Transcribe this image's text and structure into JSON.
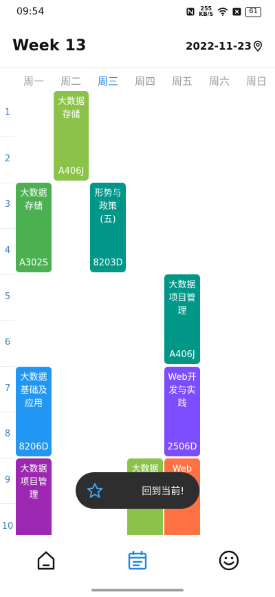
{
  "status": {
    "time": "09:54",
    "net_speed_value": "255",
    "net_speed_unit": "KB/S",
    "battery": "61"
  },
  "header": {
    "week_title": "Week 13",
    "date": "2022-11-23"
  },
  "days": [
    "周一",
    "周二",
    "周三",
    "周四",
    "周五",
    "周六",
    "周日"
  ],
  "active_day": "周三",
  "periods": [
    "1",
    "2",
    "3",
    "4",
    "5",
    "6",
    "7",
    "8",
    "9",
    "10"
  ],
  "courses": [
    {
      "name": "大数据存储",
      "room": "A406J",
      "color": "#8bc34a"
    },
    {
      "name": "大数据存储",
      "room": "A302S",
      "color": "#4caf50"
    },
    {
      "name": "形势与政策(五)",
      "room": "8203D",
      "color": "#009688"
    },
    {
      "name": "大数据项目管理",
      "room": "A406J",
      "color": "#009688"
    },
    {
      "name": "大数据基础及应用",
      "room": "8206D",
      "color": "#2196f3"
    },
    {
      "name": "Web开发与实践",
      "room": "2506D",
      "color": "#7c4dff"
    },
    {
      "name": "大数据项目管理",
      "room": "",
      "color": "#9c27b0"
    },
    {
      "name": "大数据",
      "room": "",
      "color": "#8bc34a"
    },
    {
      "name": "Web",
      "room": "",
      "color": "#ff7043"
    }
  ],
  "toast": {
    "text": "回到当前!",
    "icon": "star-outline-icon"
  },
  "bottom_nav": [
    {
      "icon": "home-icon"
    },
    {
      "icon": "calendar-icon",
      "active": true
    },
    {
      "icon": "smiley-icon"
    }
  ],
  "accent_color": "#1e88e5"
}
